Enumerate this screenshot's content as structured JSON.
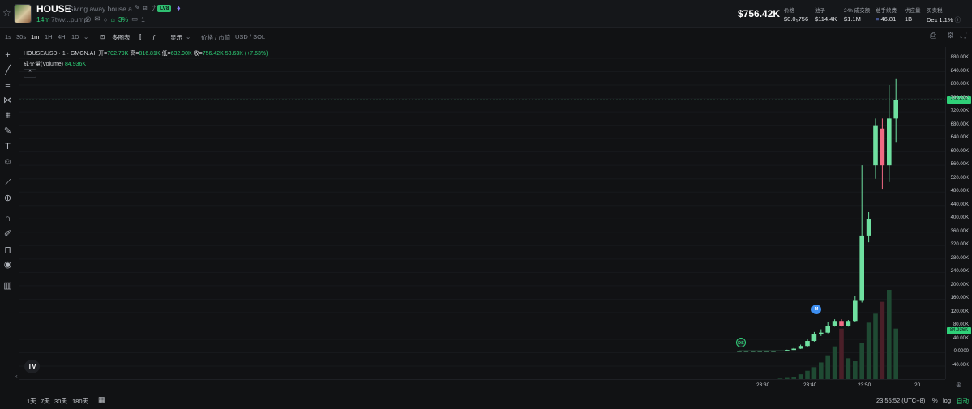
{
  "header": {
    "token_name": "HOUSE",
    "token_desc": "Giving away house a...",
    "level_badge": "LV8",
    "age": "14m",
    "address": "7twv...pump",
    "holders_pct": "3%",
    "comments": "1",
    "price": "$756.42K",
    "stats": [
      {
        "label": "价格",
        "value": "$0.0₅756"
      },
      {
        "label": "池子",
        "value": "$114.4K"
      },
      {
        "label": "24h 成交额",
        "value": "$1.1M"
      },
      {
        "label": "总手续费",
        "value": "46.81"
      },
      {
        "label": "供应量",
        "value": "1B"
      },
      {
        "label": "买卖税",
        "value": "Dex 1.1%"
      }
    ]
  },
  "toolbar": {
    "intervals": [
      "1s",
      "30s",
      "1m",
      "1H",
      "4H",
      "1D"
    ],
    "active_interval": "1m",
    "multi_chart": "多图表",
    "display": "显示",
    "price_mcap": "价格 / 市值",
    "currency": "USD / SOL"
  },
  "legend": {
    "pair": "HOUSE/USD · 1 · GMGN.AI",
    "open_label": "开=",
    "open": "702.79K",
    "high_label": "高=",
    "high": "816.81K",
    "low_label": "低=",
    "low": "632.90K",
    "close_label": "收=",
    "close": "756.42K",
    "change": "53.63K (+7.63%)",
    "volume_label": "成交量(Volume)",
    "volume": "84.936K"
  },
  "y_axis": {
    "ticks": [
      "880.00K",
      "840.00K",
      "800.00K",
      "760.00K",
      "720.00K",
      "680.00K",
      "640.00K",
      "600.00K",
      "560.00K",
      "520.00K",
      "480.00K",
      "440.00K",
      "400.00K",
      "360.00K",
      "320.00K",
      "280.00K",
      "240.00K",
      "200.00K",
      "160.00K",
      "120.00K",
      "80.00K",
      "40.00K",
      "0.0000",
      "-40.00K"
    ],
    "price_tag": "756.42K",
    "volume_tag": "84.936K",
    "price_tag_color": "#2fd078",
    "volume_tag_color": "#2fd078"
  },
  "x_axis": {
    "ticks": [
      "23:30",
      "23:40",
      "23:50",
      "20"
    ]
  },
  "markers": [
    {
      "label": "DS",
      "color": "#2fd078"
    },
    {
      "label": "M",
      "color": "#3d8ef0"
    }
  ],
  "chart_data": {
    "type": "candlestick",
    "x": [
      "23:31",
      "23:32",
      "23:33",
      "23:34",
      "23:35",
      "23:36",
      "23:37",
      "23:38",
      "23:39",
      "23:40",
      "23:41",
      "23:42",
      "23:43",
      "23:44",
      "23:45",
      "23:46",
      "23:47",
      "23:48",
      "23:49",
      "23:50",
      "23:51",
      "23:52",
      "23:53",
      "23:54"
    ],
    "open": [
      5,
      5,
      5,
      5,
      5,
      5,
      5,
      6,
      8,
      12,
      20,
      35,
      55,
      60,
      80,
      95,
      80,
      95,
      155,
      350,
      560,
      670,
      560,
      700
    ],
    "close": [
      5,
      5,
      5,
      5,
      5,
      5,
      6,
      8,
      12,
      20,
      35,
      55,
      60,
      80,
      95,
      80,
      95,
      155,
      350,
      400,
      680,
      560,
      700,
      756
    ],
    "high": [
      5,
      5,
      5,
      5,
      5,
      5,
      6,
      9,
      14,
      24,
      40,
      62,
      70,
      92,
      100,
      100,
      98,
      170,
      560,
      420,
      700,
      700,
      800,
      820
    ],
    "low": [
      5,
      5,
      5,
      5,
      5,
      5,
      5,
      6,
      8,
      11,
      18,
      33,
      50,
      58,
      78,
      78,
      78,
      93,
      150,
      330,
      520,
      490,
      510,
      630
    ],
    "volume": [
      0,
      0,
      0,
      0,
      0,
      0,
      1,
      2,
      4,
      8,
      14,
      20,
      28,
      40,
      55,
      85,
      35,
      30,
      60,
      95,
      110,
      130,
      150,
      85
    ],
    "ylim": [
      -40000,
      880000
    ]
  },
  "bottombar": {
    "ranges": [
      "1天",
      "7天",
      "30天",
      "180天"
    ],
    "time": "23:55:52 (UTC+8)",
    "pct": "%",
    "log": "log",
    "auto": "自动"
  }
}
